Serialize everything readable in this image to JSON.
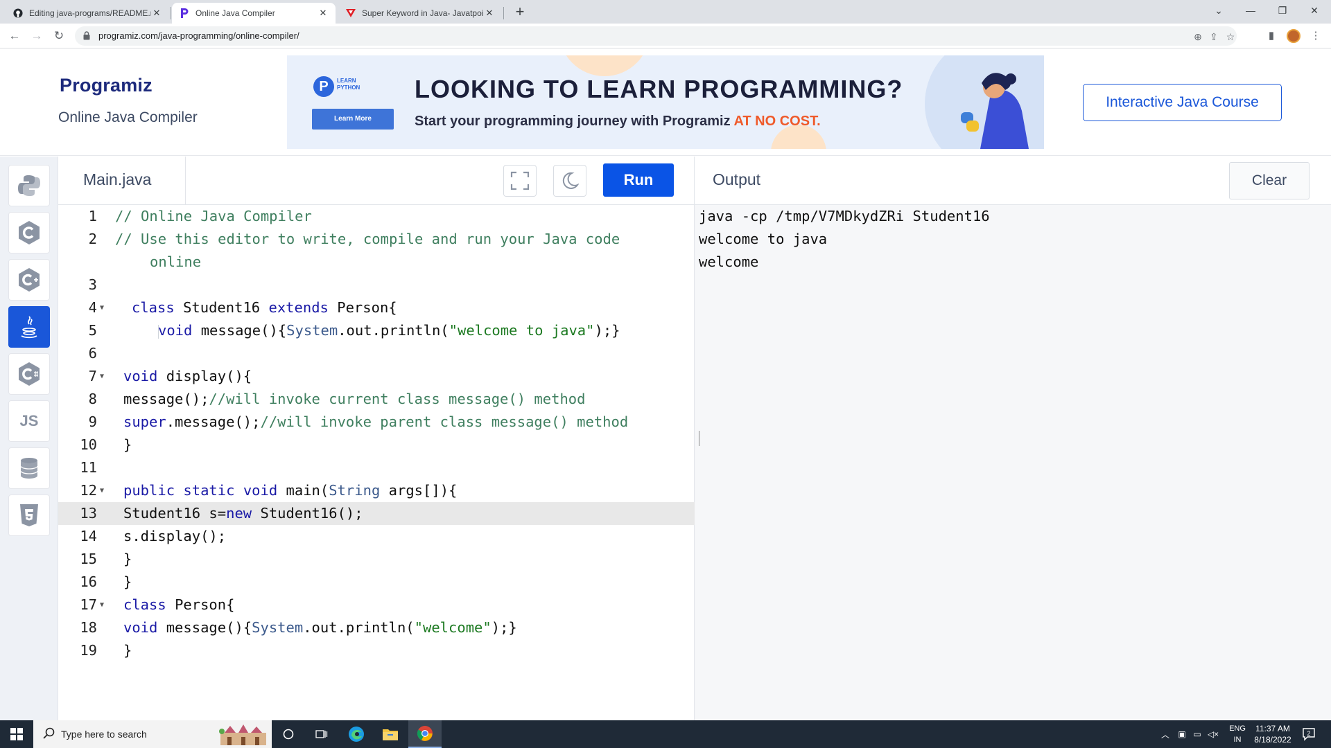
{
  "browser": {
    "tabs": [
      {
        "title": "Editing java-programs/README.md",
        "icon": "github-icon"
      },
      {
        "title": "Online Java Compiler",
        "icon": "programiz-icon"
      },
      {
        "title": "Super Keyword in Java- Javatpoint",
        "icon": "javatpoint-icon"
      }
    ],
    "url": "programiz.com/java-programming/online-compiler/"
  },
  "header": {
    "logo": "Programiz",
    "subtitle": "Online Java Compiler",
    "banner": {
      "tag": "LEARN PYTHON",
      "button": "Learn More",
      "headline": "LOOKING TO LEARN PROGRAMMING?",
      "subline": "Start your programming journey with Programiz",
      "subline_accent": "AT NO COST."
    },
    "course_button": "Interactive Java Course"
  },
  "sidebar": {
    "languages": [
      "python-icon",
      "c-icon",
      "cpp-icon",
      "java-icon",
      "csharp-icon",
      "js-icon",
      "sql-icon",
      "html5-icon"
    ],
    "js_label": "JS"
  },
  "editor": {
    "filename": "Main.java",
    "run_label": "Run",
    "lines": [
      {
        "n": "1"
      },
      {
        "n": "2"
      },
      {
        "n": ""
      },
      {
        "n": "3"
      },
      {
        "n": "4"
      },
      {
        "n": "5"
      },
      {
        "n": "6"
      },
      {
        "n": "7"
      },
      {
        "n": "8"
      },
      {
        "n": "9"
      },
      {
        "n": "10"
      },
      {
        "n": "11"
      },
      {
        "n": "12"
      },
      {
        "n": "13"
      },
      {
        "n": "14"
      },
      {
        "n": "15"
      },
      {
        "n": "16"
      },
      {
        "n": "17"
      },
      {
        "n": "18"
      },
      {
        "n": "19"
      }
    ],
    "code": {
      "l1": "// Online Java Compiler",
      "l2": "// Use this editor to write, compile and run your Java code",
      "l2b": "online",
      "l4_kw1": "class",
      "l4_name": "Student16",
      "l4_kw2": "extends",
      "l4_rest": "Person{",
      "l5_kw": "void",
      "l5_a": "message(){",
      "l5_cls": "System",
      "l5_b": ".out.println(",
      "l5_str": "\"welcome to java\"",
      "l5_c": ");}",
      "l7_kw": "void",
      "l7_rest": "display(){",
      "l8_a": "message();",
      "l8_cm": "//will invoke current class message() method",
      "l9_kw": "super",
      "l9_a": ".message();",
      "l9_cm": "//will invoke parent class message() method",
      "l10": "}",
      "l12_kw1": "public",
      "l12_kw2": "static",
      "l12_kw3": "void",
      "l12_a": "main(",
      "l12_cls": "String",
      "l12_b": "args[]){",
      "l13_a": "Student16 s=",
      "l13_kw": "new",
      "l13_b": "Student16();",
      "l14": "s.display();",
      "l15": "}",
      "l16": "}",
      "l17_kw": "class",
      "l17_rest": "Person{",
      "l18_kw": "void",
      "l18_a": "message(){",
      "l18_cls": "System",
      "l18_b": ".out.println(",
      "l18_str": "\"welcome\"",
      "l18_c": ");}",
      "l19": "}"
    }
  },
  "output": {
    "title": "Output",
    "clear_label": "Clear",
    "lines": [
      "java -cp /tmp/V7MDkydZRi Student16",
      "welcome to java",
      "welcome"
    ]
  },
  "taskbar": {
    "search_placeholder": "Type here to search",
    "lang": "ENG",
    "region": "IN",
    "time": "11:37 AM",
    "date": "8/18/2022",
    "notifications": "2"
  }
}
